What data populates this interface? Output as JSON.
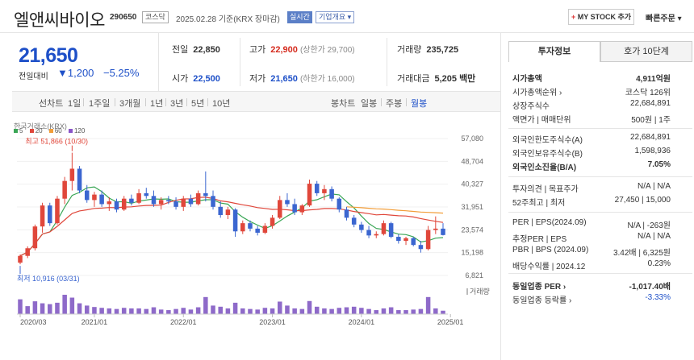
{
  "header": {
    "company_name": "엘앤씨바이오",
    "code": "290650",
    "market": "코스닥",
    "date_text": "2025.02.28 기준(KRX 장마감)",
    "live_label": "실시간",
    "overview_label": "기업개요 ▾",
    "mystock_plus": "+",
    "mystock_label": "MY STOCK 추가",
    "quick_order": "빠른주문 ▾"
  },
  "price": {
    "current": "21,650",
    "change_label": "전일대비",
    "change_value": "▼1,200",
    "change_pct": "−5.25%"
  },
  "summary": {
    "prev_close_label": "전일",
    "prev_close": "22,850",
    "high_label": "고가",
    "high": "22,900",
    "upper_limit": "(상한가 29,700)",
    "volume_label": "거래량",
    "volume": "235,725",
    "open_label": "시가",
    "open": "22,500",
    "low_label": "저가",
    "low": "21,650",
    "lower_limit": "(하한가 16,000)",
    "amount_label": "거래대금",
    "amount": "5,205 백만"
  },
  "period_bar": {
    "line_label": "선차트",
    "periods": [
      "1일",
      "1주일",
      "3개월",
      "1년",
      "3년",
      "5년",
      "10년"
    ],
    "candle_label": "봉차트",
    "candles": [
      "일봉",
      "주봉",
      "월봉"
    ],
    "active_candle": "월봉"
  },
  "chart_data": {
    "type": "candlestick",
    "source_label": "한국거래소(KRX)",
    "moving_averages": [
      {
        "name": "5",
        "color": "#3aa655"
      },
      {
        "name": "20",
        "color": "#e0473b"
      },
      {
        "name": "60",
        "color": "#f29d38"
      },
      {
        "name": "120",
        "color": "#8a55c8"
      }
    ],
    "y_ticks": [
      "57,080",
      "48,704",
      "40,327",
      "31,951",
      "23,574",
      "15,198",
      "6,821"
    ],
    "y_tick_values": [
      57080,
      48704,
      40327,
      31951,
      23574,
      15198,
      6821
    ],
    "ylim": [
      6821,
      57080
    ],
    "x_ticks": [
      "2020/03",
      "2021/01",
      "2022/01",
      "2023/01",
      "2024/01",
      "2025/01"
    ],
    "x_tick_months": [
      0,
      10,
      22,
      34,
      46,
      58
    ],
    "max_label": "최고 51,866 (10/30)",
    "min_label": "최저 10,916 (03/31)",
    "volume_label": "거래량",
    "candles": [
      {
        "o": 11500,
        "h": 14500,
        "l": 10916,
        "c": 14000
      },
      {
        "o": 14000,
        "h": 17500,
        "l": 13200,
        "c": 16800
      },
      {
        "o": 16800,
        "h": 25500,
        "l": 16000,
        "c": 24800
      },
      {
        "o": 24800,
        "h": 33500,
        "l": 22500,
        "c": 32500
      },
      {
        "o": 32500,
        "h": 33500,
        "l": 25000,
        "c": 26000
      },
      {
        "o": 26000,
        "h": 36000,
        "l": 25500,
        "c": 35000
      },
      {
        "o": 35000,
        "h": 43000,
        "l": 33000,
        "c": 41500
      },
      {
        "o": 41500,
        "h": 51866,
        "l": 38000,
        "c": 46000
      },
      {
        "o": 46000,
        "h": 47000,
        "l": 37000,
        "c": 38000
      },
      {
        "o": 38000,
        "h": 40000,
        "l": 33500,
        "c": 34500
      },
      {
        "o": 34500,
        "h": 37500,
        "l": 32000,
        "c": 36500
      },
      {
        "o": 36500,
        "h": 38000,
        "l": 32000,
        "c": 33000
      },
      {
        "o": 33000,
        "h": 35500,
        "l": 30500,
        "c": 34000
      },
      {
        "o": 34000,
        "h": 35000,
        "l": 30000,
        "c": 31000
      },
      {
        "o": 31000,
        "h": 36000,
        "l": 30500,
        "c": 35000
      },
      {
        "o": 35000,
        "h": 36500,
        "l": 32500,
        "c": 33500
      },
      {
        "o": 33500,
        "h": 38500,
        "l": 33000,
        "c": 37000
      },
      {
        "o": 37000,
        "h": 39000,
        "l": 35000,
        "c": 36000
      },
      {
        "o": 36000,
        "h": 38000,
        "l": 32000,
        "c": 33000
      },
      {
        "o": 33000,
        "h": 35500,
        "l": 31000,
        "c": 34500
      },
      {
        "o": 34500,
        "h": 36000,
        "l": 33000,
        "c": 34000
      },
      {
        "o": 34000,
        "h": 35500,
        "l": 31000,
        "c": 32000
      },
      {
        "o": 32000,
        "h": 36000,
        "l": 30500,
        "c": 35000
      },
      {
        "o": 35000,
        "h": 36500,
        "l": 32000,
        "c": 33000
      },
      {
        "o": 33000,
        "h": 38000,
        "l": 32500,
        "c": 37000
      },
      {
        "o": 37000,
        "h": 45000,
        "l": 34000,
        "c": 36000
      },
      {
        "o": 36000,
        "h": 38000,
        "l": 31000,
        "c": 32000
      },
      {
        "o": 32000,
        "h": 34000,
        "l": 28000,
        "c": 29000
      },
      {
        "o": 29000,
        "h": 32000,
        "l": 27500,
        "c": 31000
      },
      {
        "o": 31000,
        "h": 31500,
        "l": 21000,
        "c": 23000
      },
      {
        "o": 23000,
        "h": 27000,
        "l": 22000,
        "c": 26000
      },
      {
        "o": 26000,
        "h": 27000,
        "l": 23000,
        "c": 24000
      },
      {
        "o": 24000,
        "h": 25000,
        "l": 21500,
        "c": 22500
      },
      {
        "o": 22500,
        "h": 26000,
        "l": 22000,
        "c": 25000
      },
      {
        "o": 25000,
        "h": 29000,
        "l": 24000,
        "c": 28000
      },
      {
        "o": 28000,
        "h": 36000,
        "l": 27500,
        "c": 34500
      },
      {
        "o": 34500,
        "h": 37000,
        "l": 32000,
        "c": 33000
      },
      {
        "o": 33000,
        "h": 35000,
        "l": 29000,
        "c": 30000
      },
      {
        "o": 30000,
        "h": 33000,
        "l": 29000,
        "c": 32500
      },
      {
        "o": 32500,
        "h": 42000,
        "l": 32000,
        "c": 40500
      },
      {
        "o": 40500,
        "h": 41500,
        "l": 36000,
        "c": 37000
      },
      {
        "o": 37000,
        "h": 40000,
        "l": 34500,
        "c": 38500
      },
      {
        "o": 38500,
        "h": 39500,
        "l": 34000,
        "c": 35000
      },
      {
        "o": 35000,
        "h": 35500,
        "l": 30000,
        "c": 31000
      },
      {
        "o": 31000,
        "h": 32000,
        "l": 27000,
        "c": 28000
      },
      {
        "o": 28000,
        "h": 29000,
        "l": 24500,
        "c": 25500
      },
      {
        "o": 25500,
        "h": 26500,
        "l": 22500,
        "c": 23500
      },
      {
        "o": 23500,
        "h": 25000,
        "l": 20500,
        "c": 21500
      },
      {
        "o": 21500,
        "h": 23000,
        "l": 20500,
        "c": 22000
      },
      {
        "o": 22000,
        "h": 27000,
        "l": 21500,
        "c": 26000
      },
      {
        "o": 26000,
        "h": 26500,
        "l": 20500,
        "c": 21000
      },
      {
        "o": 21000,
        "h": 22000,
        "l": 18500,
        "c": 19500
      },
      {
        "o": 19500,
        "h": 21000,
        "l": 18000,
        "c": 20500
      },
      {
        "o": 20500,
        "h": 21000,
        "l": 17500,
        "c": 18000
      },
      {
        "o": 18000,
        "h": 19500,
        "l": 15200,
        "c": 16500
      },
      {
        "o": 16500,
        "h": 25000,
        "l": 16000,
        "c": 23500
      },
      {
        "o": 23500,
        "h": 28500,
        "l": 22000,
        "c": 24000
      },
      {
        "o": 24000,
        "h": 26000,
        "l": 21500,
        "c": 21650
      }
    ],
    "volumes": [
      52,
      28,
      45,
      38,
      35,
      40,
      68,
      58,
      38,
      30,
      25,
      22,
      20,
      18,
      22,
      20,
      20,
      18,
      24,
      16,
      14,
      18,
      22,
      16,
      24,
      60,
      30,
      26,
      20,
      40,
      20,
      18,
      16,
      22,
      20,
      44,
      30,
      20,
      18,
      46,
      26,
      20,
      18,
      22,
      24,
      26,
      22,
      18,
      14,
      20,
      24,
      14,
      14,
      16,
      18,
      60,
      20,
      12
    ]
  },
  "sidepanel": {
    "tab_active": "투자정보",
    "tab_other": "호가 10단계",
    "rows_a": [
      {
        "label": "시가총액",
        "value": "4,911억원",
        "bold": true
      },
      {
        "label": "시가총액순위 ›",
        "value": "코스닥 126위"
      },
      {
        "label": "상장주식수",
        "value": "22,684,891"
      },
      {
        "label": "액면가 | 매매단위",
        "value": "500원 | 1주"
      }
    ],
    "rows_b": [
      {
        "label": "외국인한도주식수(A)",
        "value": "22,684,891"
      },
      {
        "label": "외국인보유주식수(B)",
        "value": "1,598,936"
      },
      {
        "label": "외국인소진율(B/A)",
        "value": "7.05%",
        "bold": true
      }
    ],
    "rows_c": [
      {
        "label": "투자의견 | 목표주가",
        "value": "N/A | N/A"
      },
      {
        "label": "52주최고 | 최저",
        "value": "27,450 | 15,000"
      }
    ],
    "rows_d": [
      {
        "label": "PER | EPS(2024.09)",
        "value": "N/A | -263원"
      },
      {
        "label": "추정PER | EPS",
        "value": "N/A | N/A"
      },
      {
        "label": "PBR | BPS (2024.09)",
        "value": "3.42배 | 6,325원"
      },
      {
        "label": "배당수익률 | 2024.12",
        "value": "0.23%"
      }
    ],
    "rows_e": [
      {
        "label": "동일업종 PER ›",
        "value": "-1,017.40배",
        "bold": true
      },
      {
        "label": "동일업종 등락률 ›",
        "value": "-3.33%",
        "blue": true
      }
    ]
  }
}
